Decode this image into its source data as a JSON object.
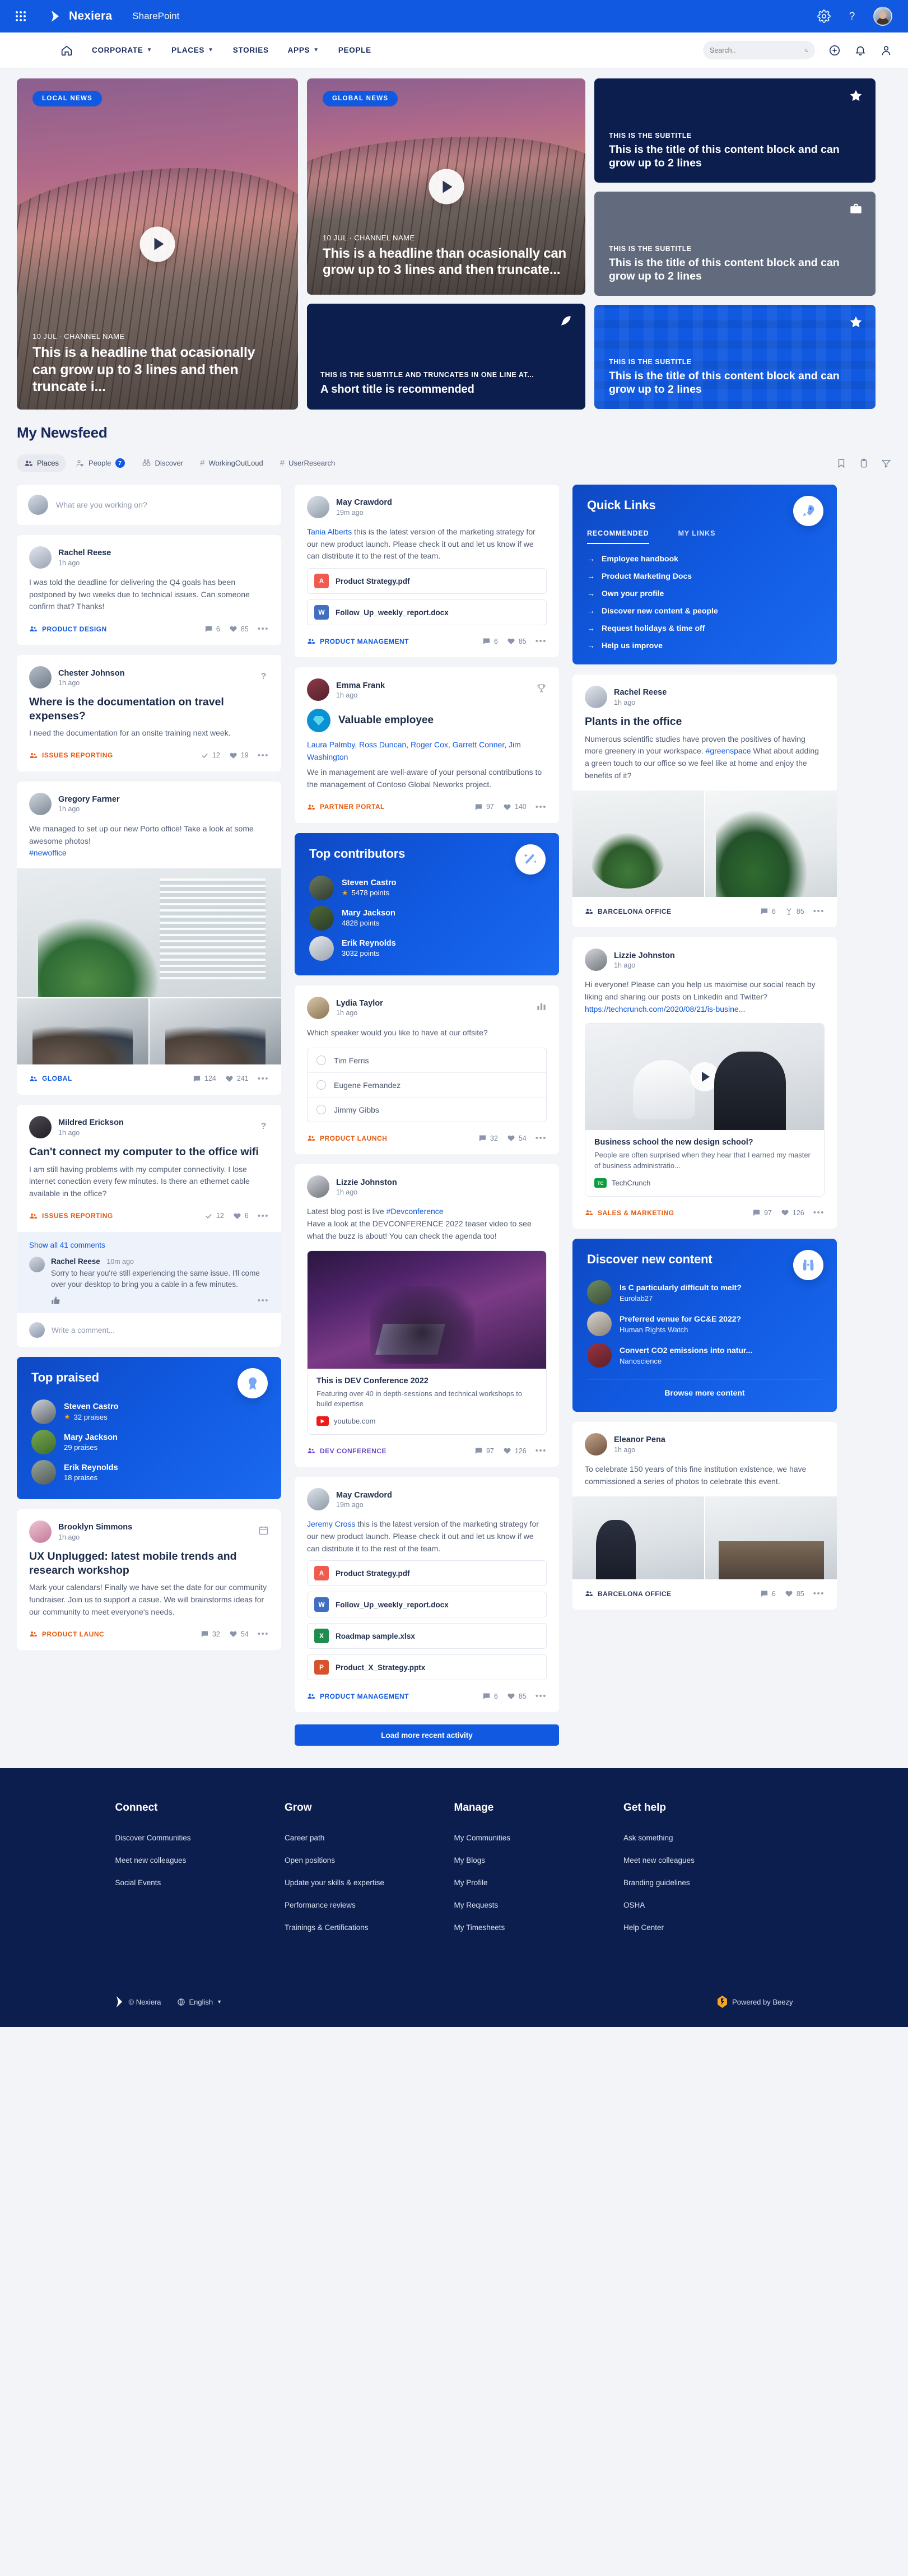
{
  "topbar": {
    "brand": "Nexiera",
    "tenant": "SharePoint",
    "icons": [
      "waffle-icon",
      "gear-icon",
      "help-icon",
      "user-avatar"
    ]
  },
  "nav": {
    "items": [
      {
        "label": "CORPORATE",
        "caret": true
      },
      {
        "label": "PLACES",
        "caret": true
      },
      {
        "label": "STORIES",
        "caret": false
      },
      {
        "label": "APPS",
        "caret": true
      },
      {
        "label": "PEOPLE",
        "caret": false
      }
    ],
    "search_placeholder": "Search..",
    "search_value": ""
  },
  "hero": {
    "big": {
      "badge": "LOCAL NEWS",
      "meta": "10 JUL · CHANNEL NAME",
      "title": "This is a headline that ocasionally can grow up to 3 lines and then truncate i..."
    },
    "mid_top": {
      "badge": "GLOBAL NEWS",
      "meta": "10 JUL · CHANNEL NAME",
      "title": "This is a headline than ocasionally can grow up to 3 lines and then truncate..."
    },
    "mid_bottom": {
      "subtitle": "THIS IS THE SUBTITLE AND TRUNCATES IN ONE LINE AT...",
      "title": "A short title is recommended",
      "icon": "feather-icon"
    },
    "right_blocks": [
      {
        "subtitle": "THIS IS THE SUBTITLE",
        "title": "This is the title of this content block and can grow up to 2 lines",
        "icon": "star-icon",
        "style": "navy"
      },
      {
        "subtitle": "THIS IS THE SUBTITLE",
        "title": "This is the title of this content block and can grow up to 2 lines",
        "icon": "briefcase-icon",
        "style": "gray"
      },
      {
        "subtitle": "THIS IS THE SUBTITLE",
        "title": "This is the title of this content block and can grow up to 2 lines",
        "icon": "star-icon",
        "style": "blue"
      }
    ]
  },
  "feed": {
    "title": "My Newsfeed",
    "chips": [
      {
        "label": "Places",
        "icon": "people-group-icon",
        "active": true,
        "badge": null
      },
      {
        "label": "People",
        "icon": "person-heart-icon",
        "active": false,
        "badge": "7"
      },
      {
        "label": "Discover",
        "icon": "binoculars-icon",
        "active": false,
        "badge": null
      },
      {
        "label": "WorkingOutLoud",
        "icon": "hash-icon",
        "active": false,
        "badge": null
      },
      {
        "label": "UserResearch",
        "icon": "hash-icon",
        "active": false,
        "badge": null
      }
    ],
    "tools": [
      "bookmark-icon",
      "clipboard-icon",
      "filter-icon"
    ],
    "composer_placeholder": "What are you working on?",
    "load_more": "Load more recent activity"
  },
  "posts": {
    "rachel_q4": {
      "name": "Rachel Reese",
      "time": "1h ago",
      "body": "I was told the deadline for delivering the Q4 goals has been postponed by two weeks due to technical issues. Can someone confirm that? Thanks!",
      "channel": "PRODUCT DESIGN",
      "comments": "6",
      "likes": "85"
    },
    "chester": {
      "name": "Chester Johnson",
      "time": "1h ago",
      "title": "Where is the documentation on travel expenses?",
      "body": "I need the documentation for an onsite training next week.",
      "channel": "ISSUES REPORTING",
      "answers": "12",
      "likes": "19",
      "flag": "question-icon"
    },
    "gregory": {
      "name": "Gregory Farmer",
      "time": "1h ago",
      "body": "We managed to set up our new Porto office! Take a look at some awesome photos!",
      "tag": "#newoffice",
      "channel": "GLOBAL",
      "comments": "124",
      "likes": "241"
    },
    "mildred": {
      "name": "Mildred Erickson",
      "time": "1h ago",
      "title": "Can't connect my computer to the office wifi",
      "body": "I am still having problems with my computer connectivity. I lose internet conection every few minutes. Is there an ethernet cable available in the office?",
      "channel": "ISSUES REPORTING",
      "answers": "12",
      "likes": "6",
      "flag": "question-icon",
      "show_all": "Show all 41 comments",
      "comment": {
        "name": "Rachel Reese",
        "time": "10m ago",
        "text": "Sorry to hear you're still experiencing the same issue. I'll come over your desktop to bring you a cable in a few minutes."
      },
      "write_placeholder": "Write a comment..."
    },
    "brooklyn": {
      "name": "Brooklyn Simmons",
      "time": "1h ago",
      "title": "UX Unplugged: latest mobile trends and research workshop",
      "body": "Mark your calendars! Finally we have set the date for our community fundraiser. Join us to support a casue. We will brainstorms ideas for our community to meet everyone's needs.",
      "channel": "PRODUCT LAUNC",
      "comments": "32",
      "likes": "54",
      "flag": "calendar-icon"
    },
    "may_files": {
      "name": "May Crawdord",
      "time": "19m ago",
      "mention": "Tania Alberts",
      "body": " this is the latest version of the marketing strategy for our new product launch. Please check it out and let us know if we can distribute it to the rest of the team.",
      "files": [
        {
          "name": "Product Strategy.pdf",
          "type": "pdf",
          "glyph": "A"
        },
        {
          "name": "Follow_Up_weekly_report.docx",
          "type": "doc",
          "glyph": "W"
        }
      ],
      "channel": "PRODUCT MANAGEMENT",
      "comments": "6",
      "likes": "85"
    },
    "emma": {
      "name": "Emma Frank",
      "time": "1h ago",
      "award": "Valuable employee",
      "mentions": "Laura Palmby, Ross Duncan, Roger Cox, Garrett Conner, Jim Washington",
      "body": "We in management are well-aware of your personal contributions to the management of Contoso Global Neworks project.",
      "channel": "PARTNER PORTAL",
      "comments": "97",
      "likes": "140",
      "flag": "trophy-icon"
    },
    "lydia": {
      "name": "Lydia Taylor",
      "time": "1h ago",
      "question": "Which speaker would you like to have at our offsite?",
      "options": [
        "Tim Ferris",
        "Eugene Fernandez",
        "Jimmy Gibbs"
      ],
      "channel": "PRODUCT LAUNCH",
      "votes": "32",
      "likes": "54",
      "flag": "poll-icon"
    },
    "lizzie_dev": {
      "name": "Lizzie Johnston",
      "time": "1h ago",
      "lead": "Latest blog post is live ",
      "tag": "#Devconference",
      "body": "Have a look at the DEVCONFERENCE 2022 teaser video to see what the buzz is about! You can check the agenda too!",
      "preview": {
        "title": "This is DEV Conference 2022",
        "desc": "Featuring over 40 in depth-sessions and technical workshops to build expertise",
        "source": "youtube.com",
        "source_badge": "yt"
      },
      "channel": "DEV CONFERENCE",
      "comments": "97",
      "likes": "126"
    },
    "may_files2": {
      "name": "May Crawdord",
      "time": "19m ago",
      "mention": "Jeremy Cross",
      "body": " this is the latest version of the marketing strategy for our new product launch. Please check it out and let us know if we can distribute it to the rest of the team.",
      "files": [
        {
          "name": "Product Strategy.pdf",
          "type": "pdf",
          "glyph": "A"
        },
        {
          "name": "Follow_Up_weekly_report.docx",
          "type": "doc",
          "glyph": "W"
        },
        {
          "name": "Roadmap sample.xlsx",
          "type": "xls",
          "glyph": "X"
        },
        {
          "name": "Product_X_Strategy.pptx",
          "type": "ppt",
          "glyph": "P"
        }
      ],
      "channel": "PRODUCT MANAGEMENT",
      "comments": "6",
      "likes": "85"
    },
    "rachel_plants": {
      "name": "Rachel Reese",
      "time": "1h ago",
      "title": "Plants in the office",
      "body_a": "Numerous scientific studies have proven the positives of having more greenery in your workspace. ",
      "tag": "#greenspace",
      "body_b": " What about adding a green touch to our office so we feel like at home and enjoy the benefits of it?",
      "channel": "BARCELONA OFFICE",
      "comments": "6",
      "likes": "85"
    },
    "lizzie_tc": {
      "name": "Lizzie Johnston",
      "time": "1h ago",
      "body": "Hi everyone! Please can you help us maximise our social reach by liking and sharing our posts on Linkedin and Twitter?",
      "link": "https://techcrunch.com/2020/08/21/is-busine...",
      "preview": {
        "title": "Business school the new design school?",
        "desc": "People are often surprised when they hear that I earned my master of business administratio...",
        "source": "TechCrunch",
        "source_badge": "tc"
      },
      "channel": "SALES & MARKETING",
      "comments": "97",
      "likes": "126"
    },
    "eleanor": {
      "name": "Eleanor Pena",
      "time": "1h ago",
      "body": "To celebrate 150 years of this fine institution existence, we have commissioned a series of photos to celebrate this event.",
      "channel": "BARCELONA OFFICE",
      "comments": "6",
      "likes": "85"
    }
  },
  "quick_links": {
    "title": "Quick Links",
    "icon": "rocket-icon",
    "tabs": [
      {
        "label": "RECOMMENDED",
        "active": true
      },
      {
        "label": "MY LINKS",
        "active": false
      }
    ],
    "items": [
      "Employee handbook",
      "Product Marketing Docs",
      "Own your profile",
      "Discover new content & people",
      "Request holidays & time off",
      "Help us improve"
    ]
  },
  "top_contributors": {
    "title": "Top contributors",
    "icon": "magic-wand-icon",
    "people": [
      {
        "name": "Steven Castro",
        "score": "5478 points",
        "star": true
      },
      {
        "name": "Mary Jackson",
        "score": "4828 points",
        "star": false
      },
      {
        "name": "Erik Reynolds",
        "score": "3032 points",
        "star": false
      }
    ]
  },
  "top_praised": {
    "title": "Top praised",
    "icon": "award-ribbon-icon",
    "people": [
      {
        "name": "Steven Castro",
        "score": "32 praises",
        "star": true
      },
      {
        "name": "Mary Jackson",
        "score": "29 praises",
        "star": false
      },
      {
        "name": "Erik Reynolds",
        "score": "18 praises",
        "star": false
      }
    ]
  },
  "discover": {
    "title": "Discover new content",
    "icon": "binoculars-icon",
    "items": [
      {
        "title": "Is C particularly difficult to melt?",
        "sub": "Eurolab27"
      },
      {
        "title": "Preferred venue for GC&E 2022?",
        "sub": "Human Rights Watch"
      },
      {
        "title": "Convert CO2 emissions into natur...",
        "sub": "Nanoscience"
      }
    ],
    "browse": "Browse more content"
  },
  "footer": {
    "columns": [
      {
        "heading": "Connect",
        "links": [
          "Discover Communities",
          "Meet new colleagues",
          "Social Events"
        ]
      },
      {
        "heading": "Grow",
        "links": [
          "Career path",
          "Open positions",
          "Update your skills & expertise",
          "Performance reviews",
          "Trainings & Certifications"
        ]
      },
      {
        "heading": "Manage",
        "links": [
          "My Communities",
          "My Blogs",
          "My Profile",
          "My Requests",
          "My Timesheets"
        ]
      },
      {
        "heading": "Get help",
        "links": [
          "Ask something",
          "Meet new colleagues",
          "Branding guidelines",
          "OSHA",
          "Help Center"
        ]
      }
    ],
    "copyright": "© Nexiera",
    "language": "English",
    "powered_by": "Powered by Beezy"
  },
  "colors": {
    "brand_blue": "#1059e0",
    "navy": "#0c1e4e",
    "orange": "#e8590c",
    "purple": "#7048c8",
    "gray_block": "#616b7d"
  }
}
